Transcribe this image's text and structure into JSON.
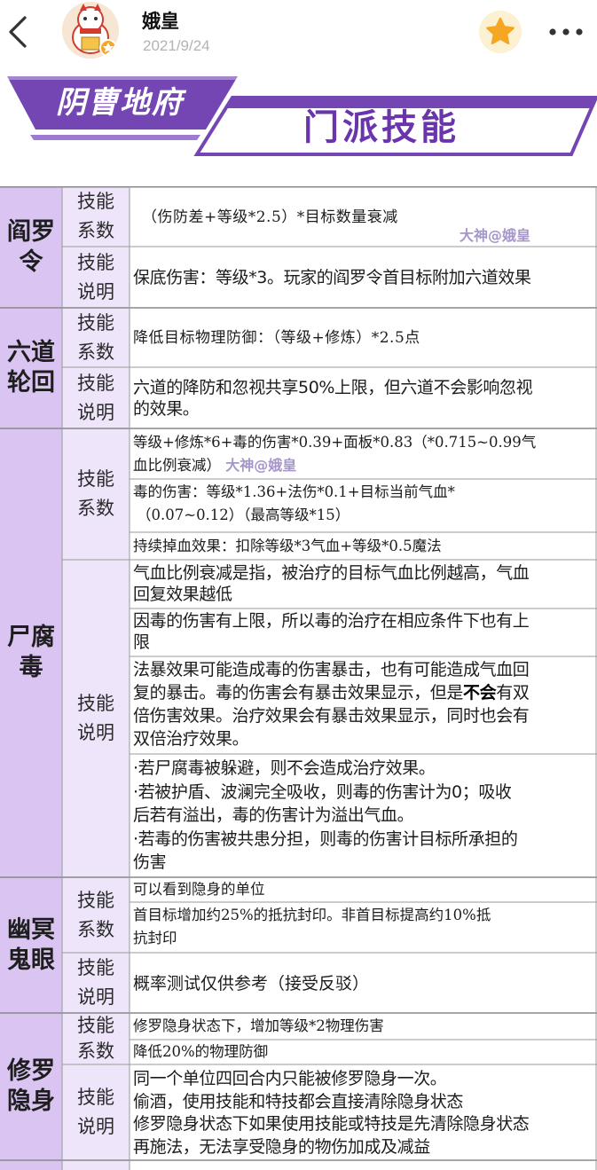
{
  "header": {
    "author": "娥皇",
    "date": "2021/9/24"
  },
  "banner": {
    "school": "阴曹地府",
    "title": "门派技能"
  },
  "labels": {
    "coef_line1": "技能",
    "coef_line2": "系数",
    "desc_line1": "技能",
    "desc_line2": "说明"
  },
  "watermark": "大神@娥皇",
  "skills": [
    {
      "name_line1": "阎罗",
      "name_line2": "令",
      "coefficient": "（伤防差+等级*2.5）*目标数量衰减",
      "description": "保底伤害：等级*3。玩家的阎罗令首目标附加六道效果"
    },
    {
      "name_line1": "六道",
      "name_line2": "轮回",
      "coefficient": "降低目标物理防御：（等级+修炼）*2.5点",
      "description_line1": "六道的降防和忽视共享50%上限，但六道不会影响忽视",
      "description_line2": "的效果。"
    },
    {
      "name_line1": "尸腐",
      "name_line2": "毒",
      "coefficient_1_line1": "等级+修炼*6+毒的伤害*0.39+面板*0.83（*0.715~0.99气",
      "coefficient_1_line2": "血比例衰减）",
      "coefficient_2_line1": "毒的伤害：等级*1.36+法伤*0.1+目标当前气血*",
      "coefficient_2_line2": "（0.07~0.12）（最高等级*15）",
      "coefficient_3": "持续掉血效果：扣除等级*3气血+等级*0.5魔法",
      "desc_1_line1": "气血比例衰减是指，被治疗的目标气血比例越高，气血",
      "desc_1_line2": "回复效果越低",
      "desc_2_line1": "因毒的伤害有上限，所以毒的治疗在相应条件下也有上",
      "desc_2_line2": "限",
      "desc_3_line1": "法暴效果可能造成毒的伤害暴击，也有可能造成气血回",
      "desc_3_line2": "复的暴击。毒的伤害会有暴击效果显示，但是",
      "desc_3_bold": "不会",
      "desc_3_line2b": "有双",
      "desc_3_line3": "倍伤害效果。治疗效果会有暴击效果显示，同时也会有",
      "desc_3_line4": "双倍治疗效果。",
      "desc_4_line1": "·若尸腐毒被躲避，则不会造成治疗效果。",
      "desc_4_line2": "·若被护盾、波澜完全吸收，则毒的伤害计为0；吸收",
      "desc_4_line3": "后若有溢出，毒的伤害计为溢出气血。",
      "desc_4_line4": "·若毒的伤害被共患分担，则毒的伤害计目标所承担的",
      "desc_4_line5": "伤害"
    },
    {
      "name_line1": "幽冥",
      "name_line2": "鬼眼",
      "coefficient_1": "可以看到隐身的单位",
      "coefficient_2_line1": "首目标增加约25%的抵抗封印。非首目标提高约10%抵",
      "coefficient_2_line2": "抗封印",
      "description": "概率测试仅供参考（接受反驳）"
    },
    {
      "name_line1": "修罗",
      "name_line2": "隐身",
      "coefficient_1": "修罗隐身状态下，增加等级*2物理伤害",
      "coefficient_2": "降低20%的物理防御",
      "desc_line1": "同一个单位四回合内只能被修罗隐身一次。",
      "desc_line2": "偷酒，使用技能和特技都会直接清除隐身状态",
      "desc_line3": "修罗隐身状态下如果使用技能或特技是先清除隐身状态",
      "desc_line4": "再施法，无法享受隐身的物伤加成及减益"
    }
  ],
  "colors": {
    "purple_dark": "#7446b3",
    "purple_label_bg": "#efe5fb",
    "purple_name_bg": "#d9c4f2",
    "star": "#f5a623"
  }
}
